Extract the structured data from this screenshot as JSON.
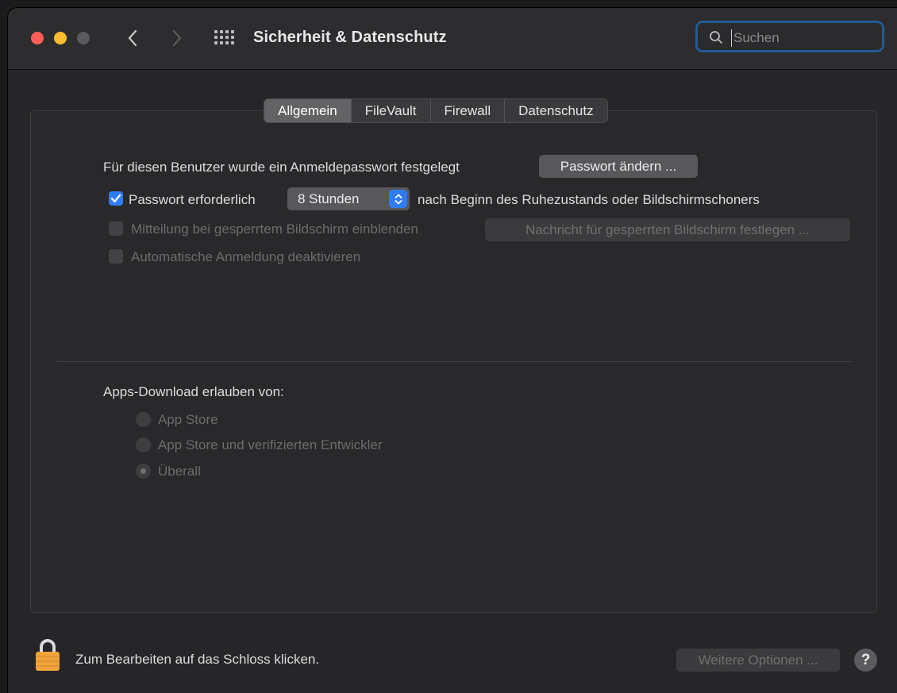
{
  "window": {
    "title": "Sicherheit & Datenschutz"
  },
  "search": {
    "placeholder": "Suchen"
  },
  "tabs": [
    {
      "label": "Allgemein",
      "active": true
    },
    {
      "label": "FileVault",
      "active": false
    },
    {
      "label": "Firewall",
      "active": false
    },
    {
      "label": "Datenschutz",
      "active": false
    }
  ],
  "general": {
    "login_password_text": "Für diesen Benutzer wurde ein Anmeldepasswort festgelegt",
    "change_password_button": "Passwort ändern ...",
    "require_password_label": "Passwort erforderlich",
    "require_password_checked": true,
    "require_password_interval": "8 Stunden",
    "require_password_suffix": "nach Beginn des Ruhezustands oder Bildschirmschoners",
    "show_message_label": "Mitteilung bei gesperrtem Bildschirm einblenden",
    "set_message_button": "Nachricht für gesperrten Bildschirm festlegen ...",
    "disable_auto_login_label": "Automatische Anmeldung deaktivieren"
  },
  "downloads": {
    "heading": "Apps-Download erlauben von:",
    "options": [
      {
        "label": "App Store",
        "selected": false
      },
      {
        "label": "App Store und verifizierten Entwickler",
        "selected": false
      },
      {
        "label": "Überall",
        "selected": true
      }
    ]
  },
  "footer": {
    "lock_text": "Zum Bearbeiten auf das Schloss klicken.",
    "advanced_button": "Weitere Optionen ...",
    "help_label": "?"
  },
  "colors": {
    "accent": "#2f7cf6",
    "lock": "#f0a43c",
    "traffic_red": "#ff5f57",
    "traffic_yellow": "#febc2e"
  }
}
